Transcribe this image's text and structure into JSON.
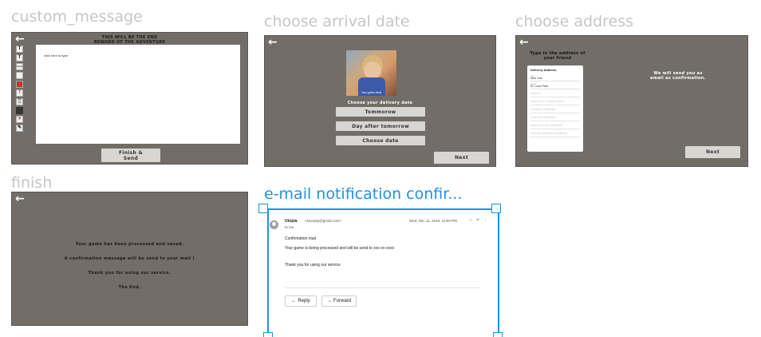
{
  "frames": {
    "custom_message": {
      "label": "custom_message",
      "header_line1": "THIS WILL BE THE END",
      "header_line2": "REWARD OF THE ADVENTURE",
      "canvas_placeholder": "click here to type",
      "tools": [
        "T",
        "T",
        "Font",
        "",
        "",
        "",
        "",
        "",
        "",
        ""
      ],
      "finish_button_line1": "Finish &",
      "finish_button_line2": "Send"
    },
    "choose_arrival": {
      "label": "choose arrival date",
      "photo_caption": "You gotta deal",
      "title": "Choose your delivery date",
      "options": [
        "Tommorow",
        "Day after tomorrow",
        "Choose date"
      ],
      "next_label": "Next"
    },
    "choose_address": {
      "label": "choose address",
      "title_line1": "Type in the address of",
      "title_line2": "your friend",
      "form_title": "Delivery Address",
      "fields": [
        {
          "label": "City",
          "value": "New York"
        },
        {
          "label": "State",
          "value": "St. Louis Park,"
        },
        {
          "placeholder": "Address"
        },
        {
          "placeholder": "Apartment / Country Name"
        },
        {
          "placeholder": "Company (Optional)"
        },
        {
          "placeholder": "Postcode (Optional)"
        },
        {
          "placeholder": "Address Extras (Optional)"
        },
        {
          "placeholder": "Delivery Instruction (Optional)"
        }
      ],
      "message_line1": "We will send you as",
      "message_line2": "email as confirmation.",
      "next_label": "Next"
    },
    "finish": {
      "label": "finish",
      "lines": [
        "Your game has been processed and saved.",
        "A confirmation message will be send to your mail !",
        "Thank you for using our service.",
        "The End."
      ]
    },
    "email": {
      "label": "e-mail notification confir...",
      "sender_name": "Utopia",
      "sender_email": "<Noreply@gmail.com>",
      "date": "Wed, Dec 11, 2019, 12:50 PM",
      "to": "to me",
      "subject": "Confirmation mail",
      "body1": "Your game is being processed and will be send to xxx on xxxx",
      "body2": "Thank you for using our service",
      "reply_label": "Reply",
      "forward_label": "Forward"
    }
  },
  "colors": {
    "frame_bg": "#726d67",
    "selection": "#1e90e8",
    "label_gray": "#c6c6c6"
  }
}
